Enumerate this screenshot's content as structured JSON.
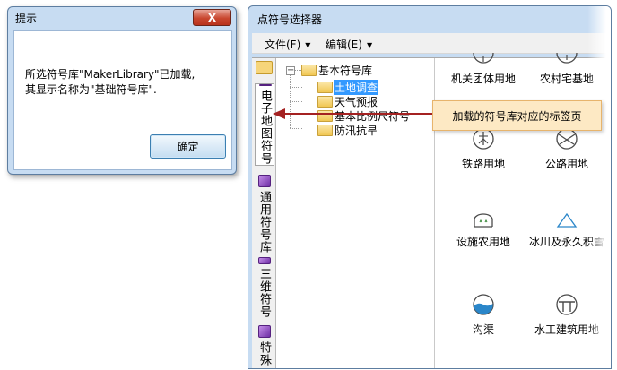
{
  "dialog": {
    "title": "提示",
    "close_glyph": "X",
    "message_line1": "所选符号库\"MakerLibrary\"已加载,",
    "message_line2": "其显示名称为\"基础符号库\".",
    "ok_label": "确定"
  },
  "selector": {
    "title": "点符号选择器",
    "menu": [
      {
        "label": "文件(F)"
      },
      {
        "label": "编辑(E)"
      }
    ],
    "vertical_tabs": [
      {
        "label": "电子地图符号"
      },
      {
        "label": "通用符号库"
      },
      {
        "label": "三维符号"
      },
      {
        "label": "特殊"
      }
    ],
    "tree": {
      "root": "基本符号库",
      "children": [
        "土地调查",
        "天气预报",
        "基本比例尺符号",
        "防汛抗旱"
      ]
    },
    "symbols": [
      {
        "label": "机关团体用地",
        "icon": "partial-circle-icon"
      },
      {
        "label": "农村宅基地",
        "icon": "partial-circle-icon"
      },
      {
        "label": "铁路用地",
        "icon": "railway-land-icon"
      },
      {
        "label": "公路用地",
        "icon": "highway-land-icon"
      },
      {
        "label": "设施农用地",
        "icon": "facility-agri-icon"
      },
      {
        "label": "冰川及永久积雪",
        "icon": "glacier-triangle-icon"
      },
      {
        "label": "沟渠",
        "icon": "ditch-icon"
      },
      {
        "label": "水工建筑用地",
        "icon": "hydraulic-building-icon"
      }
    ]
  },
  "callout": {
    "text": "加载的符号库对应的标签页"
  },
  "colors": {
    "window_frame": "#c7dcf2",
    "selection": "#3399ff",
    "callout_fill": "#fde9c4",
    "arrow": "#a42121",
    "icon_blue": "#2a86c9"
  }
}
